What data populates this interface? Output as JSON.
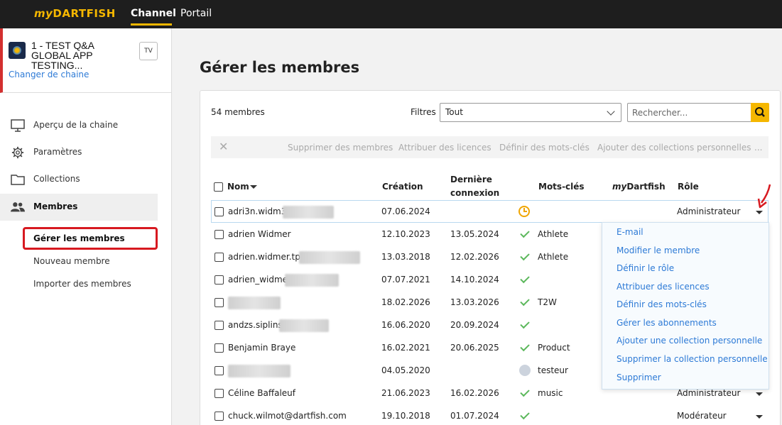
{
  "topbar": {
    "logo_my": "my",
    "logo_brand": "DARTFISH",
    "nav_channel": "Channel",
    "nav_portail": "Portail"
  },
  "channel": {
    "title": "1 - TEST Q&A GLOBAL APP TESTING...",
    "tv_label": "TV",
    "change_link": "Changer de chaine"
  },
  "sidebar": {
    "items": [
      {
        "label": "Aperçu de la chaine",
        "icon": "monitor-icon"
      },
      {
        "label": "Paramètres",
        "icon": "gear-icon"
      },
      {
        "label": "Collections",
        "icon": "folder-icon"
      },
      {
        "label": "Membres",
        "icon": "users-icon"
      }
    ],
    "sub_items": [
      "Gérer les membres",
      "Nouveau membre",
      "Importer des membres"
    ]
  },
  "main": {
    "page_title": "Gérer les membres",
    "member_count": "54 membres",
    "filters_label": "Filtres",
    "filter_value": "Tout",
    "search_placeholder": "Rechercher...",
    "bulk_actions": [
      "Supprimer des membres",
      "Attribuer des licences",
      "Définir des mots-clés",
      "Ajouter des collections personnelles",
      "..."
    ],
    "columns": {
      "name": "Nom",
      "creation": "Création",
      "last_login_1": "Dernière",
      "last_login_2": "connexion",
      "keywords": "Mots-clés",
      "mydartfish_my": "my",
      "mydartfish_rest": "Dartfish",
      "role": "Rôle"
    },
    "rows": [
      {
        "name": "adri3n.widm3r",
        "creation": "07.06.2024",
        "last": "",
        "status": "pending",
        "keywords": "",
        "role": "Administrateur"
      },
      {
        "name": "adrien Widmer",
        "creation": "12.10.2023",
        "last": "13.05.2024",
        "status": "check",
        "keywords": "Athlete",
        "role": ""
      },
      {
        "name": "adrien.widmer.tpd",
        "creation": "13.03.2018",
        "last": "12.02.2026",
        "status": "check",
        "keywords": "Athlete",
        "role": ""
      },
      {
        "name": "adrien_widmer",
        "creation": "07.07.2021",
        "last": "14.10.2024",
        "status": "check",
        "keywords": "",
        "role": ""
      },
      {
        "name": "",
        "creation": "18.02.2026",
        "last": "13.03.2026",
        "status": "check",
        "keywords": "T2W",
        "role": ""
      },
      {
        "name": "andzs.siplins",
        "creation": "16.06.2020",
        "last": "20.09.2024",
        "status": "check",
        "keywords": "",
        "role": ""
      },
      {
        "name": "Benjamin Braye",
        "creation": "16.02.2021",
        "last": "20.06.2025",
        "status": "check",
        "keywords": "Product",
        "role": ""
      },
      {
        "name": "",
        "creation": "04.05.2020",
        "last": "",
        "status": "gray",
        "keywords": "testeur",
        "role": ""
      },
      {
        "name": "Céline Baffaleuf",
        "creation": "21.06.2023",
        "last": "16.02.2026",
        "status": "check",
        "keywords": "music",
        "role": "Administrateur"
      },
      {
        "name": "chuck.wilmot@dartfish.com",
        "creation": "19.10.2018",
        "last": "01.07.2024",
        "status": "check",
        "keywords": "",
        "role": "Modérateur"
      }
    ],
    "row_menu": [
      "E-mail",
      "Modifier le membre",
      "Définir le rôle",
      "Attribuer des licences",
      "Définir des mots-clés",
      "Gérer les abonnements",
      "Ajouter une collection personnelle",
      "Supprimer la collection personnelle",
      "Supprimer"
    ]
  },
  "colors": {
    "accent": "#f5b700",
    "link": "#2d7ad6",
    "highlight_red": "#d71920",
    "check_green": "#5cb85c"
  }
}
